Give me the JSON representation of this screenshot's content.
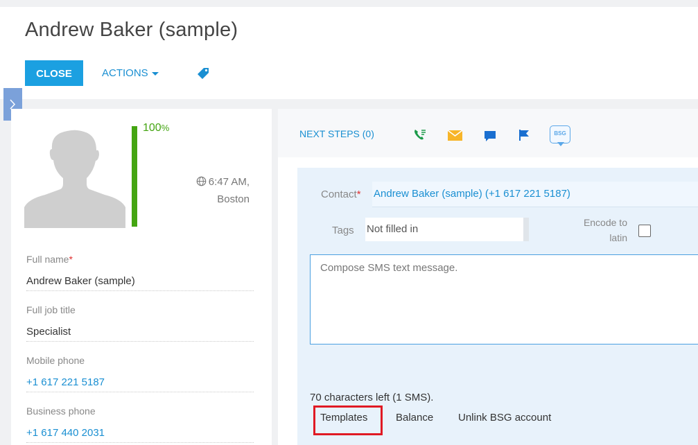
{
  "header": {
    "title": "Andrew Baker (sample)",
    "close_label": "CLOSE",
    "actions_label": "ACTIONS",
    "tag_icon": "tag-icon"
  },
  "colors": {
    "accent": "#1ba0e1",
    "link": "#1a8fd2",
    "success": "#44a512",
    "required": "#e03030",
    "highlight": "#e01a24"
  },
  "profile": {
    "completeness_value": "100",
    "completeness_unit": "%",
    "completeness_fraction": 1.0,
    "time": "6:47 AM,",
    "city": "Boston",
    "fields": [
      {
        "label": "Full name",
        "required": "*",
        "value": "Andrew Baker (sample)"
      },
      {
        "label": "Full job title",
        "value": "Specialist"
      },
      {
        "label": "Mobile phone",
        "value": "+1 617 221 5187"
      },
      {
        "label": "Business phone",
        "value": "+1 617 440 2031"
      }
    ]
  },
  "tabs": {
    "next_steps": "NEXT STEPS (0)",
    "icons": [
      "phone-icon",
      "email-icon",
      "chat-icon",
      "flag-icon",
      "bsg-sms-icon"
    ],
    "bsg_label": "BSG"
  },
  "sms": {
    "contact_label": "Contact",
    "contact_required": "*",
    "contact_value": "Andrew Baker (sample) (+1 617 221 5187)",
    "tags_label": "Tags",
    "tags_value": "Not filled in",
    "encode_label_line1": "Encode to",
    "encode_label_line2": "latin",
    "encode_checked": false,
    "message_placeholder": "Compose SMS text message.",
    "chars_left": "70 characters left (1 SMS).",
    "links": [
      "Templates",
      "Balance",
      "Unlink BSG account"
    ]
  }
}
